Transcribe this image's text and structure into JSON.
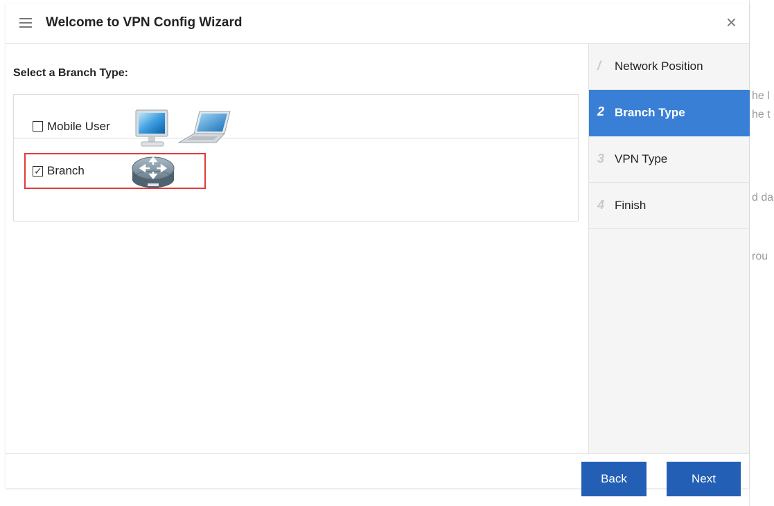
{
  "dialog": {
    "title": "Welcome to VPN Config Wizard",
    "close_glyph": "×"
  },
  "main": {
    "section_title": "Select a Branch Type:",
    "options": [
      {
        "label": "Mobile User",
        "checked": false,
        "icons": [
          "desktop-monitor-icon",
          "laptop-icon"
        ]
      },
      {
        "label": "Branch",
        "checked": true,
        "icons": [
          "router-icon"
        ]
      }
    ]
  },
  "steps": [
    {
      "num": "1",
      "label": "Network Position",
      "active": false
    },
    {
      "num": "2",
      "label": "Branch Type",
      "active": true
    },
    {
      "num": "3",
      "label": "VPN Type",
      "active": false
    },
    {
      "num": "4",
      "label": "Finish",
      "active": false
    }
  ],
  "footer": {
    "back_label": "Back",
    "next_label": "Next"
  },
  "background_page": {
    "fragments": [
      "he l",
      "he t",
      "d da",
      "rou"
    ]
  },
  "colors": {
    "accent": "#3a7fd6",
    "button": "#235fb5",
    "highlight": "#e23a3a"
  }
}
